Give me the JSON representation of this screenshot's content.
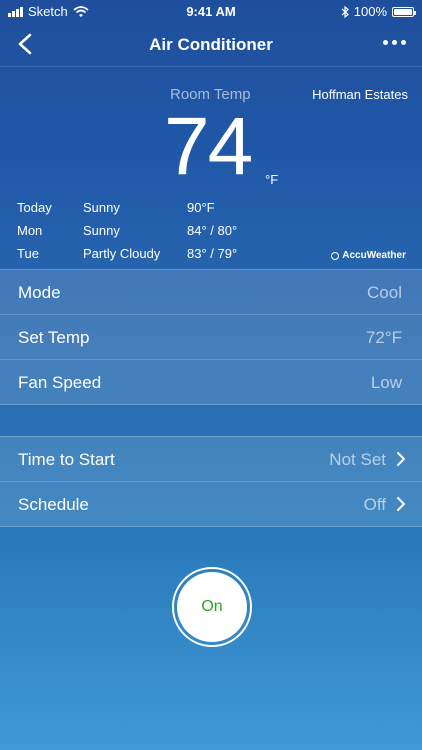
{
  "status_bar": {
    "carrier": "Sketch",
    "time": "9:41 AM",
    "battery": "100%"
  },
  "nav": {
    "title": "Air Conditioner"
  },
  "weather": {
    "room_label": "Room Temp",
    "location": "Hoffman Estates",
    "temperature": "74",
    "unit": "°F",
    "forecast": [
      {
        "day": "Today",
        "condition": "Sunny",
        "temp": "90°F"
      },
      {
        "day": "Mon",
        "condition": "Sunny",
        "temp": "84° / 80°"
      },
      {
        "day": "Tue",
        "condition": "Partly Cloudy",
        "temp": "83° / 79°"
      }
    ],
    "provider": "AccuWeather"
  },
  "settings": [
    {
      "label": "Mode",
      "value": "Cool"
    },
    {
      "label": "Set Temp",
      "value": "72°F"
    },
    {
      "label": "Fan Speed",
      "value": "Low"
    }
  ],
  "timers": [
    {
      "label": "Time to Start",
      "value": "Not Set"
    },
    {
      "label": "Schedule",
      "value": "Off"
    }
  ],
  "power": {
    "label": "On",
    "color": "#2aa524"
  }
}
